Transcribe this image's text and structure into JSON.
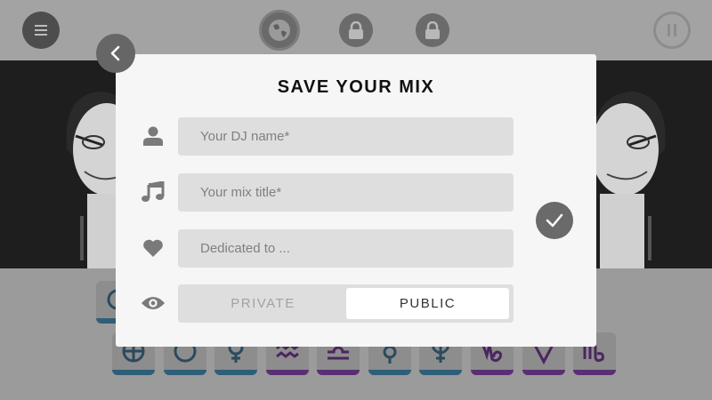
{
  "modal": {
    "title": "SAVE YOUR MIX",
    "dj_name_placeholder": "Your DJ name*",
    "mix_title_placeholder": "Your mix title*",
    "dedicated_placeholder": "Dedicated to ...",
    "visibility": {
      "options": [
        "PRIVATE",
        "PUBLIC"
      ],
      "selected": "PUBLIC"
    }
  },
  "icons": {
    "top_left": "menu-icon",
    "top_center": "globe-icon",
    "locks": [
      "lock-icon",
      "lock-icon"
    ],
    "top_right": "pause-icon",
    "back": "chevron-left-icon",
    "rows": [
      "user-icon",
      "music-note-icon",
      "heart-icon",
      "eye-icon"
    ],
    "confirm": "check-icon"
  },
  "colors": {
    "modal_bg": "#f6f6f6",
    "field_bg": "#dedede",
    "button_dark": "#6a6a6a",
    "tile_blue": "#2f5e78",
    "tile_purple": "#5a2f72"
  }
}
